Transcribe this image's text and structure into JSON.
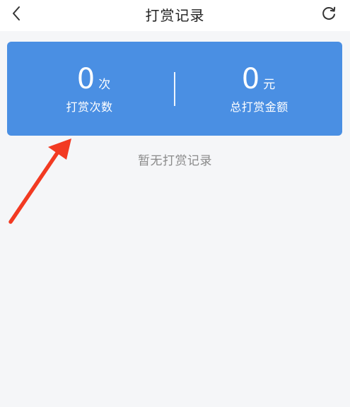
{
  "header": {
    "title": "打赏记录",
    "back_icon": "chevron-left-icon",
    "refresh_icon": "refresh-icon"
  },
  "stats": {
    "count": {
      "value": "0",
      "unit": "次",
      "label": "打赏次数"
    },
    "amount": {
      "value": "0",
      "unit": "元",
      "label": "总打赏金额"
    }
  },
  "empty_state": {
    "text": "暂无打赏记录"
  },
  "colors": {
    "card_background": "#4a8fe3",
    "page_background": "#f5f6f8",
    "annotation_arrow": "#f23a22"
  }
}
